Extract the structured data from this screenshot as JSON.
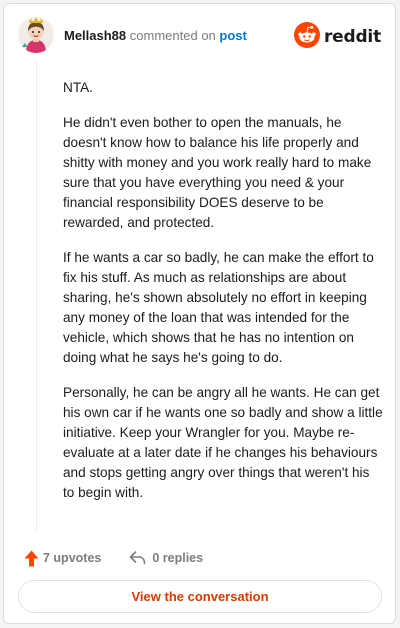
{
  "header": {
    "author": "Mellash88",
    "action_text": "commented on",
    "post_link": "post",
    "brand_name": "reddit"
  },
  "comment": {
    "paragraphs": [
      "NTA.",
      "He didn't even bother to open the manuals, he doesn't know how to balance his life properly and shitty with money and you work really hard to make sure that you have everything you need & your financial responsibility DOES deserve to be rewarded, and protected.",
      "If he wants a car so badly, he can make the effort to fix his stuff. As much as relationships are about sharing, he's shown absolutely no effort in keeping any money of the loan that was intended for the vehicle, which shows that he has no intention on doing what he says he's going to do.",
      "Personally, he can be angry all he wants. He can get his own car if he wants one so badly and show a little initiative. Keep your Wrangler for you. Maybe re-evaluate at a later date if he changes his behaviours and stops getting angry over things that weren't his to begin with."
    ]
  },
  "actions": {
    "upvotes": "7 upvotes",
    "replies": "0 replies"
  },
  "cta": {
    "label": "View the conversation"
  },
  "icons": {
    "brand": "reddit-snoo-icon",
    "upvote": "upvote-arrow-icon",
    "reply": "reply-arrow-icon"
  },
  "colors": {
    "brand_orange": "#ff4500",
    "link_blue": "#0079d3",
    "cta_text": "#d93a00",
    "muted": "#7c7c7c"
  }
}
